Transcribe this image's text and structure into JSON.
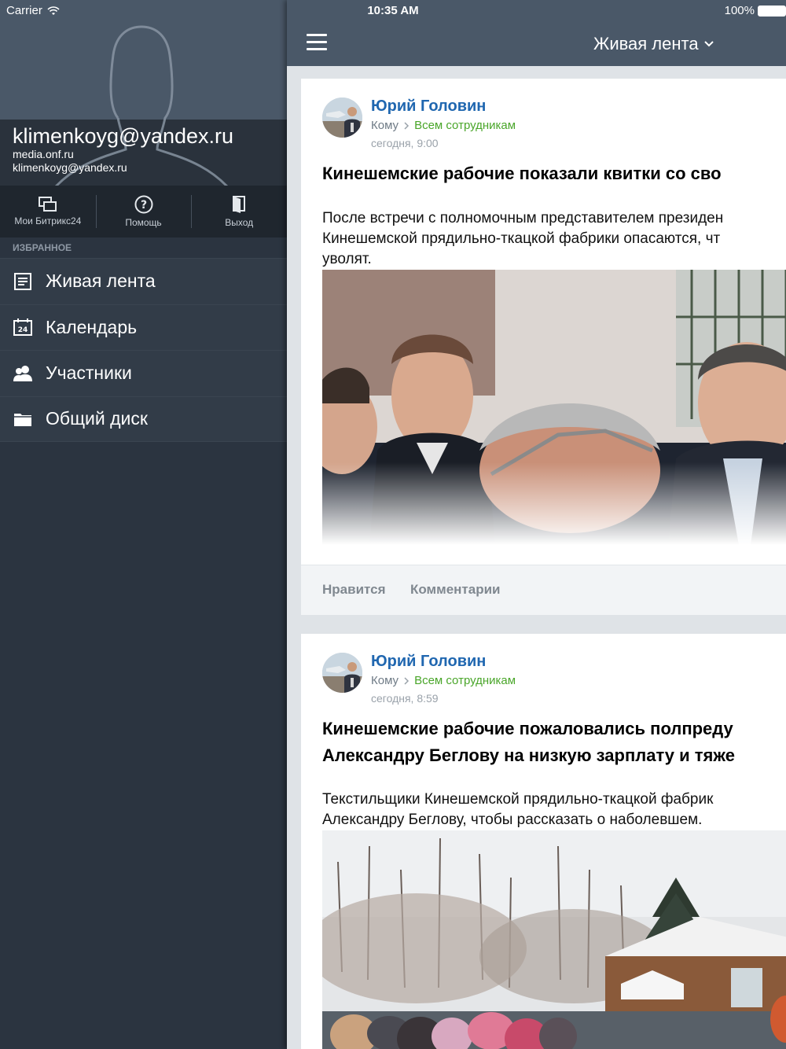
{
  "status_bar": {
    "carrier": "Carrier",
    "time": "10:35 AM",
    "battery": "100%"
  },
  "profile": {
    "name": "klimenkoyg@yandex.ru",
    "portal": "media.onf.ru",
    "login": "klimenkoyg@yandex.ru"
  },
  "actions": [
    {
      "label": "Мои Битрикс24",
      "icon": "windows-icon"
    },
    {
      "label": "Помощь",
      "icon": "help-icon"
    },
    {
      "label": "Выход",
      "icon": "exit-door-icon"
    }
  ],
  "favorites": {
    "title": "ИЗБРАННОЕ",
    "items": [
      {
        "label": "Живая лента",
        "icon": "feed-icon"
      },
      {
        "label": "Календарь",
        "icon": "calendar-icon",
        "icon_text": "24"
      },
      {
        "label": "Участники",
        "icon": "users-icon"
      },
      {
        "label": "Общий диск",
        "icon": "folder-icon"
      }
    ]
  },
  "header": {
    "title": "Живая лента"
  },
  "posts": [
    {
      "author": "Юрий Головин",
      "to_label": "Кому",
      "to_target": "Всем сотрудникам",
      "time": "сегодня, 9:00",
      "title_lines": [
        "Кинешемские рабочие показали квитки со сво"
      ],
      "text_lines": [
        "После встречи с полномочным представителем президен",
        "Кинешемской прядильно-ткацкой фабрики опасаются, чт",
        "уволят."
      ],
      "like_label": "Нравится",
      "comment_label": "Комментарии"
    },
    {
      "author": "Юрий Головин",
      "to_label": "Кому",
      "to_target": "Всем сотрудникам",
      "time": "сегодня, 8:59",
      "title_lines": [
        "Кинешемские рабочие пожаловались полпреду",
        "Александру Беглову на низкую зарплату и тяже"
      ],
      "text_lines": [
        "Текстильщики Кинешемской прядильно-ткацкой фабрик",
        "Александру Беглову, чтобы рассказать о наболевшем."
      ]
    }
  ],
  "colors": {
    "sidebar_bg": "#2b3440",
    "topbar_bg": "#4a5868",
    "author_link": "#2067b0",
    "target_green": "#4aa62a"
  }
}
